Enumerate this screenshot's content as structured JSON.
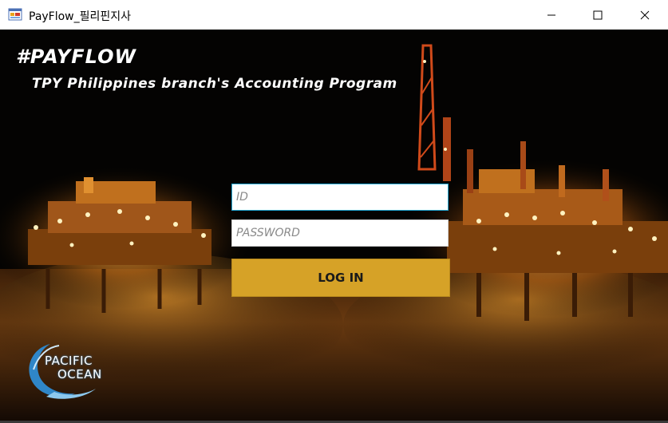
{
  "window": {
    "title": "PayFlow_필리핀지사",
    "icon": "app-window-icon",
    "controls": {
      "minimize": "minimize-icon",
      "maximize": "maximize-icon",
      "close": "close-icon"
    }
  },
  "header": {
    "brand": "#PAYFLOW",
    "subtitle": "TPY Philippines branch's Accounting Program"
  },
  "login": {
    "id_placeholder": "ID",
    "id_value": "",
    "password_placeholder": "PASSWORD",
    "password_value": "",
    "button_label": "LOG IN",
    "button_color": "#d6a227",
    "focus_border_color": "#22a7d4"
  },
  "logo": {
    "line1": "PACIFIC",
    "line2": "OCEAN"
  }
}
